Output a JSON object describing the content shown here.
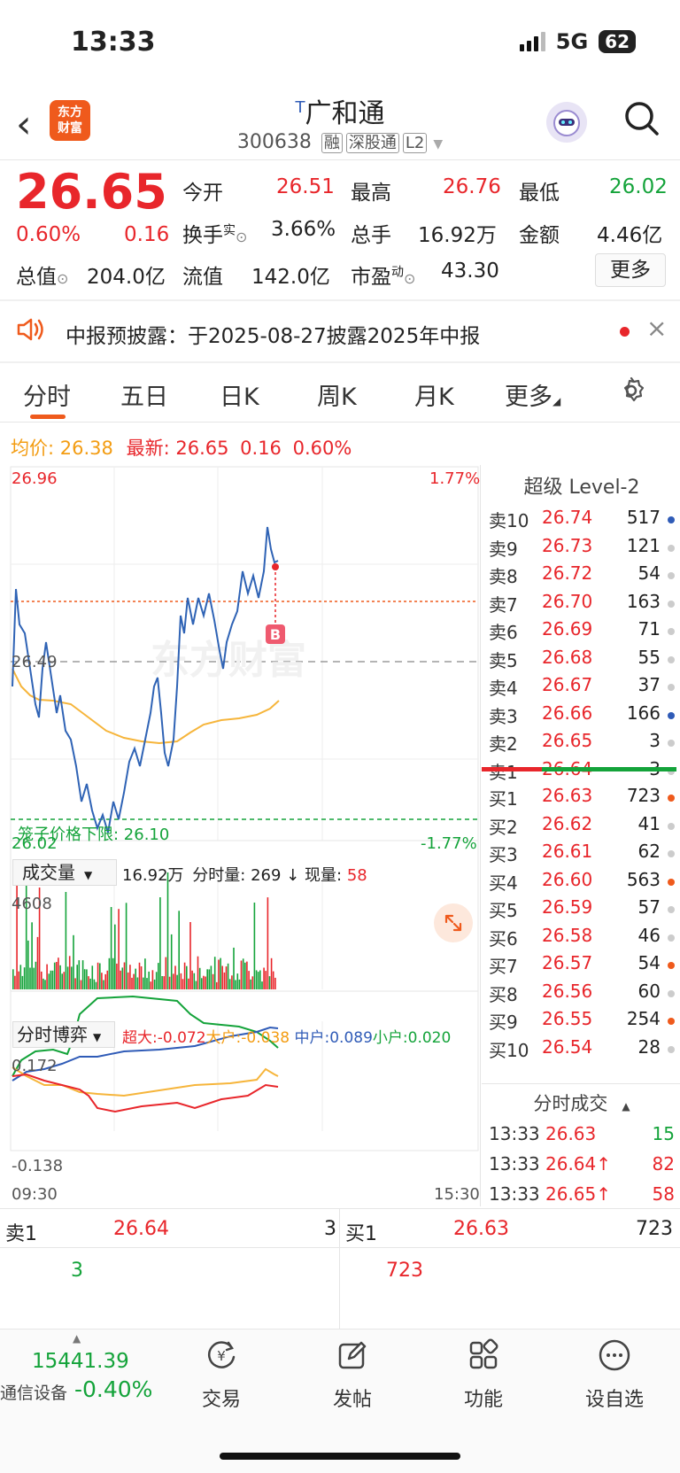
{
  "status": {
    "time": "13:33",
    "network": "5G",
    "battery": "62"
  },
  "header": {
    "logo": "东方\n财富",
    "stock_name": "广和通",
    "stock_prefix": "T",
    "code": "300638",
    "tags": [
      "融",
      "深股通",
      "L2"
    ]
  },
  "quote": {
    "price": "26.65",
    "change_pct": "0.60%",
    "change": "0.16",
    "fields": [
      {
        "label": "今开",
        "value": "26.51",
        "color": "red"
      },
      {
        "label": "最高",
        "value": "26.76",
        "color": "red"
      },
      {
        "label": "最低",
        "value": "26.02",
        "color": "green"
      },
      {
        "label": "换手",
        "value": "3.66%",
        "color": "black"
      },
      {
        "label": "总手",
        "value": "16.92万",
        "color": "black"
      },
      {
        "label": "金额",
        "value": "4.46亿",
        "color": "black"
      },
      {
        "label": "总值",
        "value": "204.0亿",
        "color": "black"
      },
      {
        "label": "流值",
        "value": "142.0亿",
        "color": "black"
      },
      {
        "label": "市盈",
        "value": "43.30",
        "color": "black"
      }
    ],
    "turnover_sup": "实",
    "pe_sup": "动",
    "more_button": "更多"
  },
  "notice": {
    "text": "中报预披露：于2025-08-27披露2025年中报"
  },
  "tabs": [
    "分时",
    "五日",
    "日K",
    "周K",
    "月K",
    "更多"
  ],
  "active_tab": "分时",
  "summary": {
    "avg_label": "均价:",
    "avg": "26.38",
    "last_label": "最新:",
    "last": "26.65",
    "chg": "0.16",
    "pct": "0.60%"
  },
  "intraday": {
    "y_top": "26.96",
    "y_mid": "26.49",
    "y_bottom": "26.02",
    "pct_top": "1.77%",
    "pct_bottom": "-1.77%",
    "lower_limit_label": "笼子价格下限: 26.10",
    "buy_marker": "B",
    "watermark": "东方财富"
  },
  "volume": {
    "selector": "成交量",
    "total": "16.92万",
    "period_label": "分时量:",
    "period": "269",
    "current_label": "现量:",
    "current": "58",
    "ymax": "4608"
  },
  "game": {
    "selector": "分时博弈",
    "super_label": "超大:",
    "super": "-0.072",
    "big_label": "大户:",
    "big": "-0.038",
    "mid_label": "中户:",
    "mid": "0.089",
    "small_label": "小户:",
    "small": "0.020",
    "ymax": "0.172",
    "ymin": "-0.138",
    "start": "09:30",
    "end": "15:30"
  },
  "orderbook": {
    "title": "超级 Level-2",
    "asks": [
      {
        "label": "卖10",
        "price": "26.74",
        "vol": "517",
        "dot": "#2f5bb7"
      },
      {
        "label": "卖9",
        "price": "26.73",
        "vol": "121",
        "dot": "#ccc"
      },
      {
        "label": "卖8",
        "price": "26.72",
        "vol": "54",
        "dot": "#ccc"
      },
      {
        "label": "卖7",
        "price": "26.70",
        "vol": "163",
        "dot": "#ccc"
      },
      {
        "label": "卖6",
        "price": "26.69",
        "vol": "71",
        "dot": "#ccc"
      },
      {
        "label": "卖5",
        "price": "26.68",
        "vol": "55",
        "dot": "#ccc"
      },
      {
        "label": "卖4",
        "price": "26.67",
        "vol": "37",
        "dot": "#ccc"
      },
      {
        "label": "卖3",
        "price": "26.66",
        "vol": "166",
        "dot": "#2f5bb7"
      },
      {
        "label": "卖2",
        "price": "26.65",
        "vol": "3",
        "dot": "#ccc"
      },
      {
        "label": "卖1",
        "price": "26.64",
        "vol": "3",
        "dot": "#ccc"
      }
    ],
    "bids": [
      {
        "label": "买1",
        "price": "26.63",
        "vol": "723",
        "dot": "#ef5a1c"
      },
      {
        "label": "买2",
        "price": "26.62",
        "vol": "41",
        "dot": "#ccc"
      },
      {
        "label": "买3",
        "price": "26.61",
        "vol": "62",
        "dot": "#ccc"
      },
      {
        "label": "买4",
        "price": "26.60",
        "vol": "563",
        "dot": "#ef5a1c"
      },
      {
        "label": "买5",
        "price": "26.59",
        "vol": "57",
        "dot": "#ccc"
      },
      {
        "label": "买6",
        "price": "26.58",
        "vol": "46",
        "dot": "#ccc"
      },
      {
        "label": "买7",
        "price": "26.57",
        "vol": "54",
        "dot": "#ef5a1c"
      },
      {
        "label": "买8",
        "price": "26.56",
        "vol": "60",
        "dot": "#ccc"
      },
      {
        "label": "买9",
        "price": "26.55",
        "vol": "254",
        "dot": "#ef5a1c"
      },
      {
        "label": "买10",
        "price": "26.54",
        "vol": "28",
        "dot": "#ccc"
      }
    ],
    "trades_title": "分时成交",
    "trades": [
      {
        "time": "13:33",
        "price": "26.63",
        "vol": "15",
        "pcolor": "red",
        "vcolor": "green"
      },
      {
        "time": "13:33",
        "price": "26.64↑",
        "vol": "82",
        "pcolor": "red",
        "vcolor": "red"
      },
      {
        "time": "13:33",
        "price": "26.65↑",
        "vol": "58",
        "pcolor": "red",
        "vcolor": "red"
      }
    ]
  },
  "bottom_quote": {
    "sell_label": "卖1",
    "sell_price": "26.64",
    "sell_vol": "3",
    "sell_count": "3",
    "buy_label": "买1",
    "buy_price": "26.63",
    "buy_vol": "723",
    "buy_count": "723"
  },
  "bottom_nav": {
    "index_value": "15441.39",
    "sector_label": "通信设备",
    "sector_change": "-0.40%",
    "items": [
      {
        "label": "交易",
        "icon": "trade-icon"
      },
      {
        "label": "发帖",
        "icon": "post-icon"
      },
      {
        "label": "功能",
        "icon": "apps-icon"
      },
      {
        "label": "设自选",
        "icon": "watchlist-icon"
      }
    ]
  }
}
